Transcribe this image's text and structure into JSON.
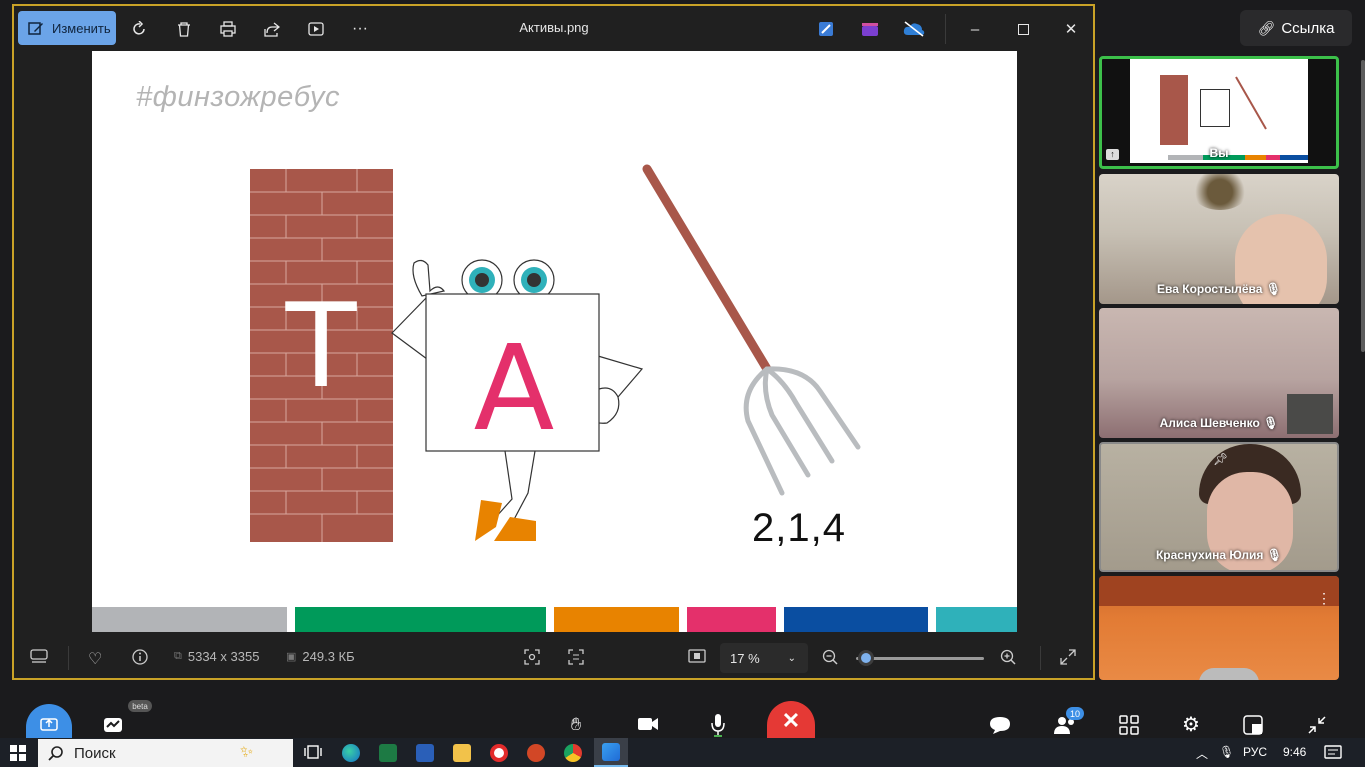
{
  "viewer": {
    "edit_label": "Изменить",
    "file_title": "Активы.png",
    "dimensions": "5334 x 3355",
    "file_size": "249.3 КБ",
    "zoom": "17 %",
    "zoom_level_percent": 17
  },
  "image": {
    "hashtag": "#финзожребус",
    "letter_wall": "Т",
    "letter_square": "А",
    "digits": "2,1,4",
    "stripe_colors": [
      "#b2b4b7",
      "#009a5a",
      "#e88300",
      "#e4306b",
      "#0a4ea1",
      "#2fb1ba"
    ]
  },
  "meeting": {
    "link_label": "Ссылка",
    "participants": [
      {
        "name": "Вы"
      },
      {
        "name": "Ева Коростылёва"
      },
      {
        "name": "Алиса Шевченко"
      },
      {
        "name": "Краснухина Юлия"
      },
      {
        "name": ""
      }
    ],
    "beta_label": "beta",
    "participants_count": "10"
  },
  "taskbar": {
    "search_placeholder": "Поиск",
    "language": "РУС",
    "time": "9:46"
  },
  "colors": {
    "accent": "#6ba4e8",
    "end_call": "#e53935",
    "window_border": "#c9a227",
    "active_tile_border": "#3cc04a"
  }
}
